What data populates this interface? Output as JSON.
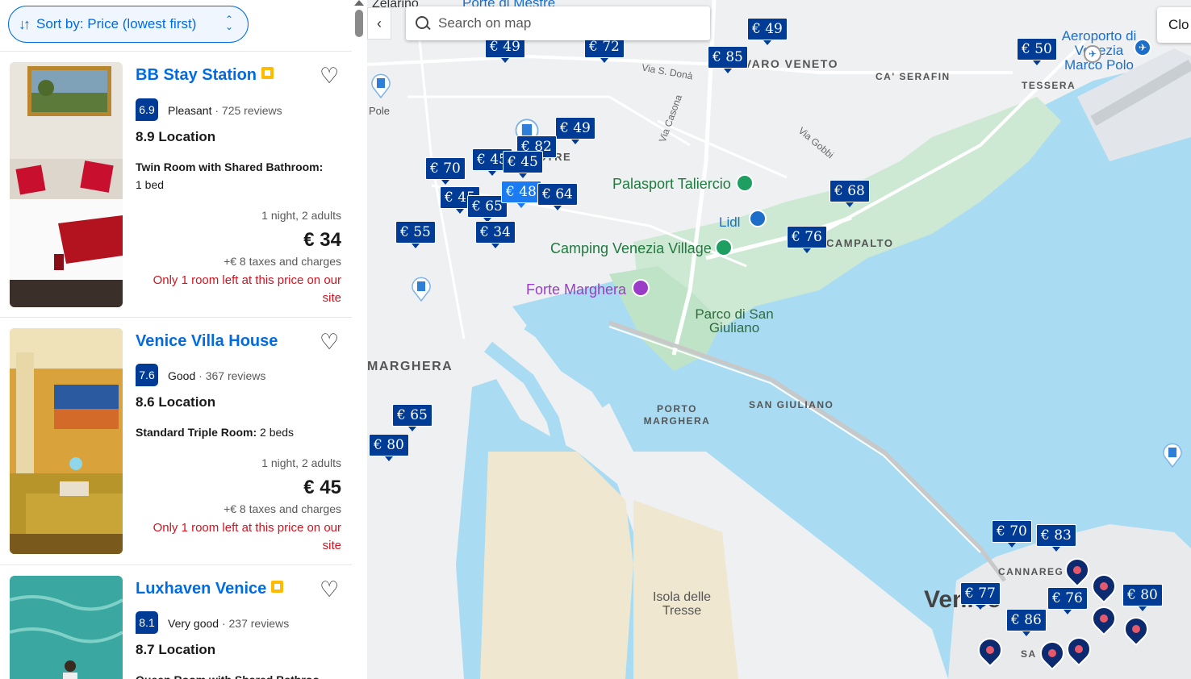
{
  "sort": {
    "label": "Sort by: Price (lowest first)"
  },
  "hotels": [
    {
      "name": "BB Stay Station",
      "score": "6.9",
      "rating_word": "Pleasant",
      "reviews": "· 725 reviews",
      "location": "8.9 Location",
      "room_type": "Twin Room with Shared Bathroom:",
      "beds": "1 bed",
      "stay": "1 night, 2 adults",
      "price": "€ 34",
      "taxes": "+€ 8 taxes and charges",
      "scarcity": "Only 1 room left at this price on our site"
    },
    {
      "name": "Venice Villa House",
      "score": "7.6",
      "rating_word": "Good",
      "reviews": "· 367 reviews",
      "location": "8.6 Location",
      "room_type": "Standard Triple Room:",
      "beds": "2 beds",
      "stay": "1 night, 2 adults",
      "price": "€ 45",
      "taxes": "+€ 8 taxes and charges",
      "scarcity": "Only 1 room left at this price on our site"
    },
    {
      "name": "Luxhaven Venice",
      "score": "8.1",
      "rating_word": "Very good",
      "reviews": "· 237 reviews",
      "location": "8.7 Location",
      "room_type": "Queen Room with Shared Bathroo",
      "beds": "",
      "stay": "",
      "price": "",
      "taxes": "",
      "scarcity": ""
    }
  ],
  "map": {
    "search_placeholder": "Search on map",
    "close_label": "Clo",
    "labels": {
      "zelarino": "Zelarino",
      "porte_mestre": "Porte di Mestre",
      "favaro": "FAVARO VENETO",
      "ca_serafin": "CA' SERAFIN",
      "tessera": "TESSERA",
      "airport": "Aeroporto di Venezia Marco Polo",
      "via_sdona": "Via S. Donà",
      "via_casona": "Via Casona",
      "via_gobbi": "Via Gobbi",
      "mestre": "MESTRE",
      "palasport": "Palasport Taliercio",
      "lidl": "Lidl",
      "camping": "Camping Venezia Village",
      "campalto": "CAMPALTO",
      "forte": "Forte Marghera",
      "parco": "Parco di San Giuliano",
      "marghera": "MARGHERA",
      "porto_marghera": "PORTO MARGHERA",
      "san_giuliano": "SAN GIULIANO",
      "isola": "Isola delle Tresse",
      "venice": "Venice",
      "cannaregio": "CANNAREG",
      "san_polo": "SA",
      "pole": "Pole"
    },
    "pins": [
      "€ 49",
      "€ 72",
      "€ 85",
      "€ 49",
      "€ 50",
      "€ 49",
      "€ 82",
      "€ 45",
      "€ 45",
      "€ 70",
      "€ 45",
      "€ 65",
      "€ 48",
      "€ 64",
      "€ 68",
      "€ 55",
      "€ 34",
      "€ 76",
      "€ 65",
      "€ 80",
      "€ 70",
      "€ 83",
      "€ 77",
      "€ 76",
      "€ 80",
      "€ 86"
    ]
  },
  "colors": {
    "accent": "#006ce4",
    "pin": "#003b95",
    "score": "#003b95",
    "scarcity": "#d4111e",
    "water": "#a9dcf2",
    "park": "#cde9d3"
  }
}
